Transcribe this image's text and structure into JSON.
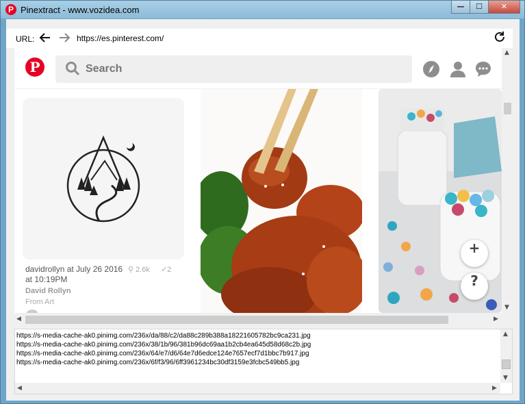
{
  "window": {
    "title": "Pinextract - www.vozidea.com",
    "min": "—",
    "max": "☐",
    "close": "✕"
  },
  "urlbar": {
    "label": "URL:",
    "url": "https://es.pinterest.com/",
    "back": "🡐",
    "forward": "🡒",
    "refresh": "⟳"
  },
  "pinterest": {
    "logo": "P",
    "search_placeholder": "Search",
    "pin": {
      "user_date": "davidrollyn at July 26 2016",
      "time": "at 10:19PM",
      "repins": "2.6k",
      "likes": "2",
      "author": "David Rollyn",
      "board": "From Art"
    },
    "fab_add": "+",
    "fab_help": "?"
  },
  "output": {
    "lines": [
      "https://s-media-cache-ak0.pinimg.com/236x/da/88/c2/da88c289b388a18221605782bc9ca231.jpg",
      "https://s-media-cache-ak0.pinimg.com/236x/38/1b/96/381b96dc69aa1b2cb4ea645d58d68c2b.jpg",
      "https://s-media-cache-ak0.pinimg.com/236x/64/e7/d6/64e7d6edce124e7657ecf7d1bbc7b917.jpg",
      "https://s-media-cache-ak0.pinimg.com/236x/6f/f3/96/6ff3961234bc30df3159e3fcbc549bb5.jpg"
    ]
  },
  "colors": {
    "pinterest_red": "#e60023",
    "titlebar": "#8dbbd8",
    "search_bg": "#efefef"
  }
}
